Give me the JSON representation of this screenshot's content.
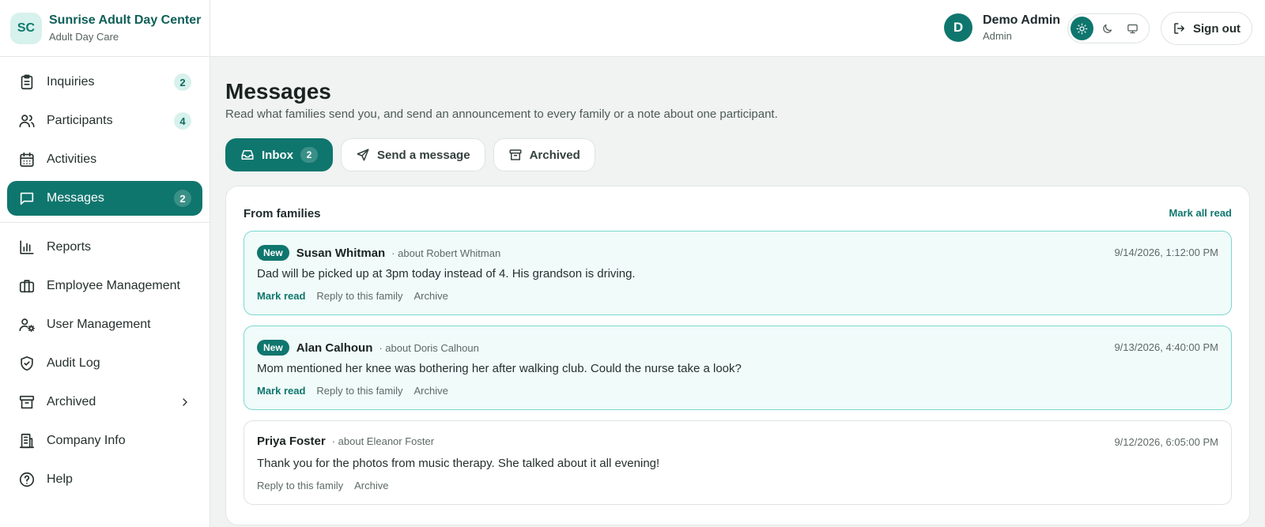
{
  "brand": {
    "initials": "SC",
    "name": "Sunrise Adult Day Center",
    "subtitle": "Adult Day Care"
  },
  "sidebar": {
    "items": [
      {
        "label": "Inquiries",
        "icon": "clipboard-icon",
        "badge": "2"
      },
      {
        "label": "Participants",
        "icon": "users-icon",
        "badge": "4"
      },
      {
        "label": "Activities",
        "icon": "calendar-icon",
        "badge": ""
      },
      {
        "label": "Messages",
        "icon": "message-icon",
        "badge": "2",
        "active": true
      },
      {
        "label": "Reports",
        "icon": "bar-chart-icon",
        "badge": ""
      },
      {
        "label": "Employee Management",
        "icon": "briefcase-icon",
        "badge": ""
      },
      {
        "label": "User Management",
        "icon": "user-cog-icon",
        "badge": ""
      },
      {
        "label": "Audit Log",
        "icon": "shield-icon",
        "badge": ""
      },
      {
        "label": "Archived",
        "icon": "archive-icon",
        "badge": ""
      },
      {
        "label": "Company Info",
        "icon": "building-icon",
        "badge": ""
      },
      {
        "label": "Help",
        "icon": "help-circle-icon",
        "badge": ""
      }
    ]
  },
  "header": {
    "user": {
      "initial": "D",
      "name": "Demo Admin",
      "role": "Admin"
    },
    "theme_modes": [
      "light",
      "dark",
      "system"
    ],
    "theme_selected": "light",
    "signout_label": "Sign out"
  },
  "main": {
    "title": "Messages",
    "description": "Read what families send you, and send an announcement to every family or a note about one participant.",
    "tabs": [
      {
        "label": "Inbox",
        "badge": "2",
        "active": true
      },
      {
        "label": "Send a message"
      },
      {
        "label": "Archived"
      }
    ],
    "panel": {
      "title": "From families",
      "mark_all_label": "Mark all read",
      "messages": [
        {
          "is_new": true,
          "new_label": "New",
          "sender": "Susan Whitman",
          "about": "· about Robert Whitman",
          "time": "9/14/2026, 1:12:00 PM",
          "body": "Dad will be picked up at 3pm today instead of 4. His grandson is driving.",
          "actions": [
            "Mark read",
            "Reply to this family",
            "Archive"
          ]
        },
        {
          "is_new": true,
          "new_label": "New",
          "sender": "Alan Calhoun",
          "about": "· about Doris Calhoun",
          "time": "9/13/2026, 4:40:00 PM",
          "body": "Mom mentioned her knee was bothering her after walking club. Could the nurse take a look?",
          "actions": [
            "Mark read",
            "Reply to this family",
            "Archive"
          ]
        },
        {
          "is_new": false,
          "sender": "Priya Foster",
          "about": "· about Eleanor Foster",
          "time": "9/12/2026, 6:05:00 PM",
          "body": "Thank you for the photos from music therapy. She talked about it all evening!",
          "actions": [
            "Reply to this family",
            "Archive"
          ]
        }
      ]
    }
  },
  "colors": {
    "accent": "#0f766e",
    "accent_light": "#d7f1ec",
    "unread_bg": "#f0fbfa",
    "unread_border": "#7bd9d1"
  }
}
